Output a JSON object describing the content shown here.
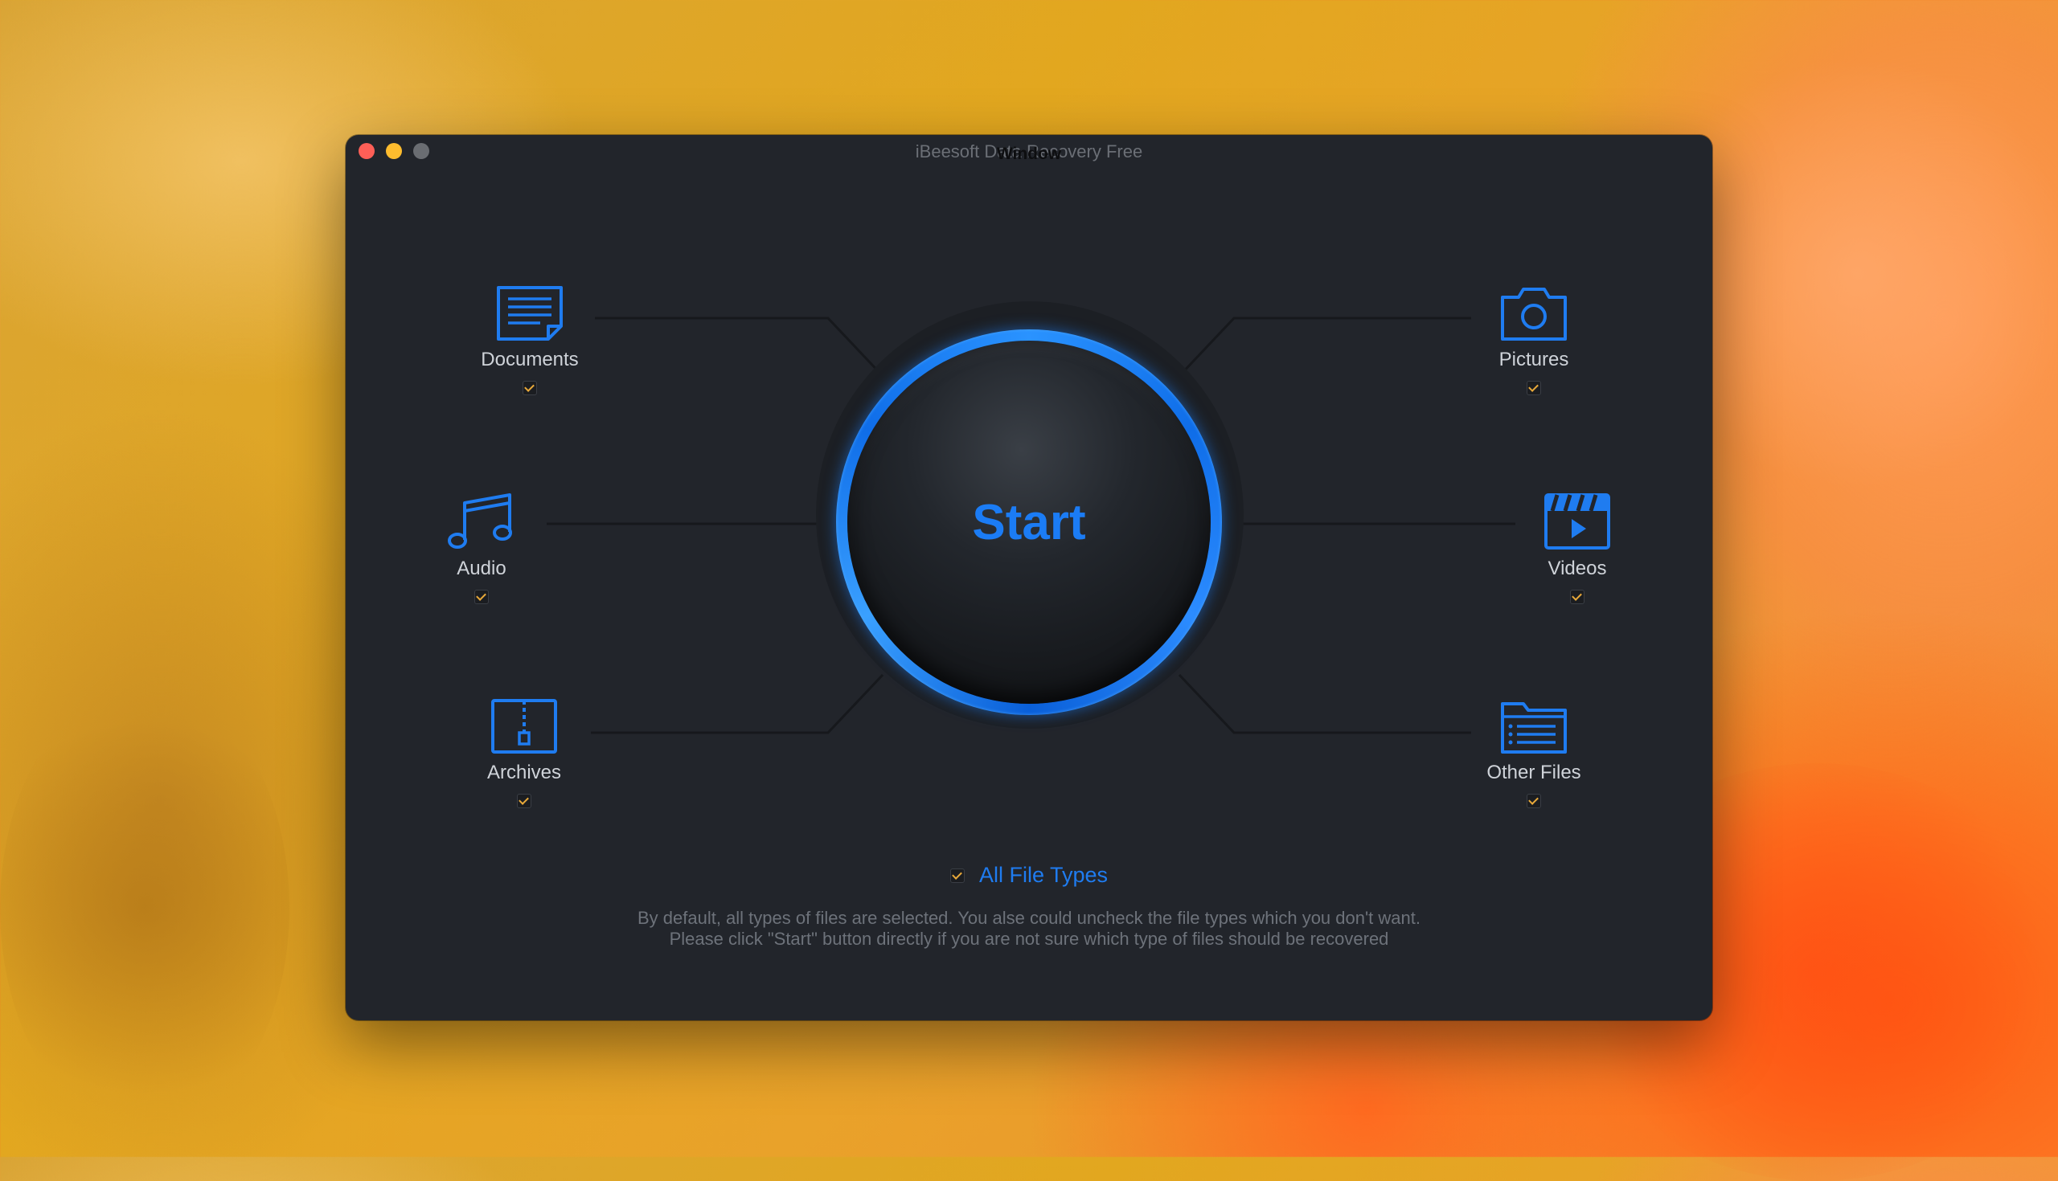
{
  "window": {
    "title": "iBeesoft Data Recovery Free",
    "title_overlay": "Window"
  },
  "file_types": {
    "documents": {
      "label": "Documents",
      "checked": true,
      "icon": "document-icon"
    },
    "pictures": {
      "label": "Pictures",
      "checked": true,
      "icon": "camera-icon"
    },
    "audio": {
      "label": "Audio",
      "checked": true,
      "icon": "music-note-icon"
    },
    "videos": {
      "label": "Videos",
      "checked": true,
      "icon": "clapperboard-icon"
    },
    "archives": {
      "label": "Archives",
      "checked": true,
      "icon": "zip-archive-icon"
    },
    "other_files": {
      "label": "Other Files",
      "checked": true,
      "icon": "folder-list-icon"
    }
  },
  "start_button": {
    "label": "Start"
  },
  "all_file_types": {
    "label": "All File Types",
    "checked": true
  },
  "description": {
    "line1": "By default, all types of files are selected. You alse could uncheck the file types which you don't want.",
    "line2": "Please click \"Start\" button directly if you are not sure which type of files should be recovered"
  },
  "colors": {
    "accent": "#1f7cf0",
    "checkmark": "#e8a93a",
    "window_bg": "#22252b"
  }
}
